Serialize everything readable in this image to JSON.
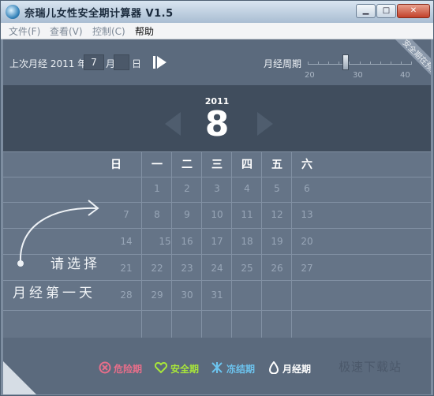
{
  "window": {
    "title": "奈瑞儿女性安全期计算器 V1.5",
    "minimize": "▁",
    "maximize": "□",
    "close": "✕"
  },
  "menu": [
    "文件(F)",
    "查看(V)",
    "控制(C)",
    "帮助"
  ],
  "topbar": {
    "last_period_label": "上次月经 2011 年",
    "month_value": "7",
    "month_unit": "月",
    "day_value": "",
    "day_unit": "日",
    "cycle_label": "月经周期",
    "slider_labels": [
      "20",
      "30",
      "40"
    ],
    "cycle_value": 28,
    "ribbon_text": "安全期在预测"
  },
  "header": {
    "year": "2011",
    "month": "8"
  },
  "calendar": {
    "weekdays": [
      "日",
      "一",
      "二",
      "三",
      "四",
      "五",
      "六"
    ],
    "rows": [
      [
        "",
        "1",
        "2",
        "3",
        "4",
        "5",
        "6"
      ],
      [
        "7",
        "8",
        "9",
        "10",
        "11",
        "12",
        "13"
      ],
      [
        "14",
        "15",
        "16",
        "17",
        "18",
        "19",
        "20"
      ],
      [
        "21",
        "22",
        "23",
        "24",
        "25",
        "26",
        "27"
      ],
      [
        "28",
        "29",
        "30",
        "31",
        "",
        "",
        ""
      ]
    ],
    "hint_line1": "请选择",
    "hint_line2": "月经第一天"
  },
  "legend": [
    {
      "label": "危险期",
      "color": "#e86e8a",
      "icon": "danger-icon"
    },
    {
      "label": "安全期",
      "color": "#a8e63a",
      "icon": "heart-icon"
    },
    {
      "label": "冻结期",
      "color": "#6cc3ee",
      "icon": "snowflake-icon"
    },
    {
      "label": "月经期",
      "color": "#ffffff",
      "icon": "drop-icon"
    }
  ],
  "watermark": "极速下载站"
}
